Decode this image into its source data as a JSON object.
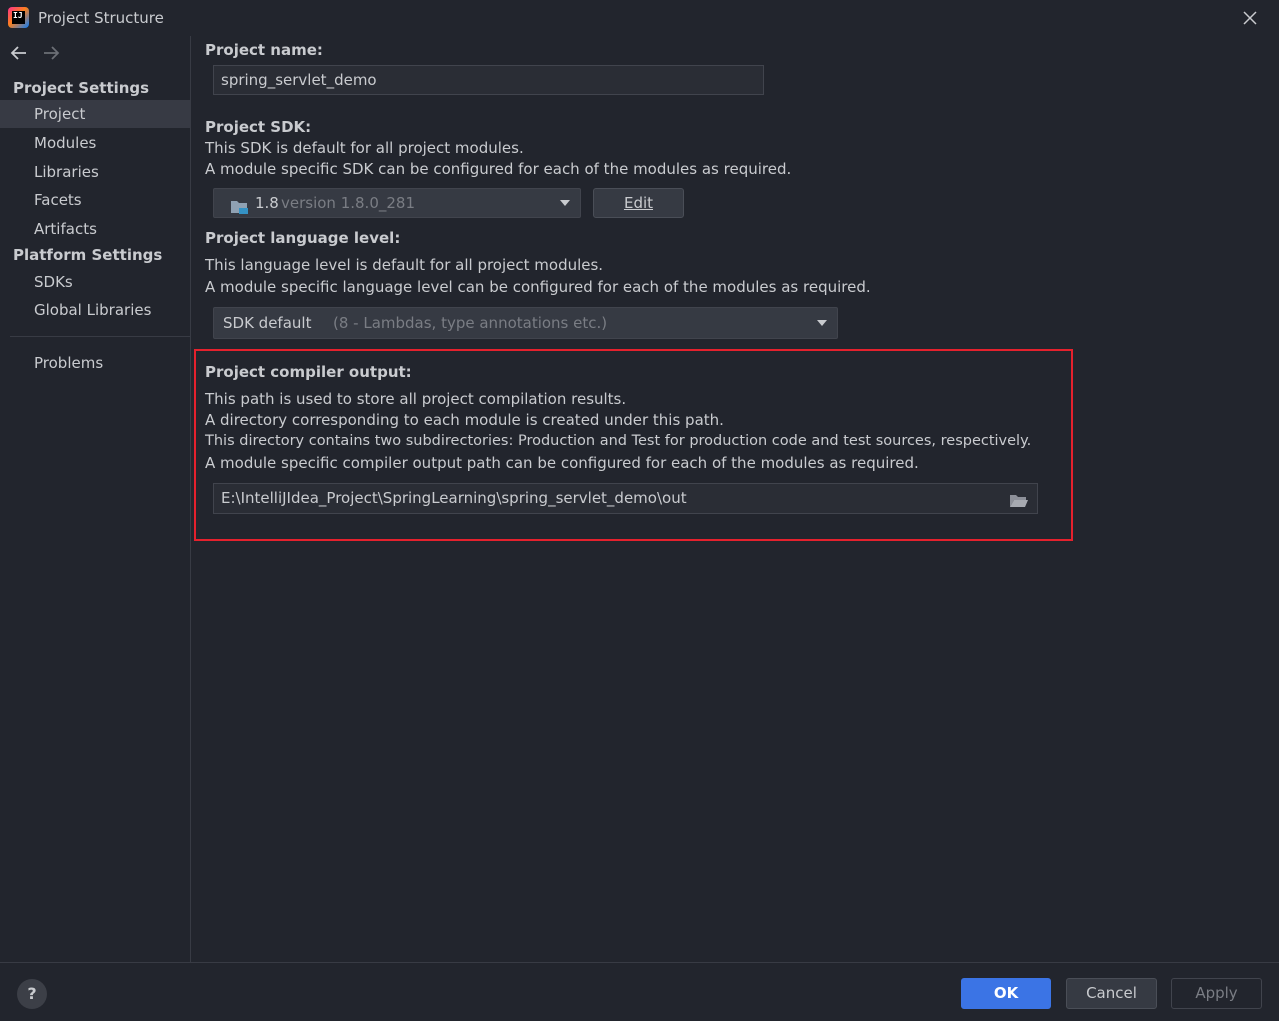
{
  "window": {
    "title": "Project Structure",
    "logo_text": "IJ"
  },
  "sidebar": {
    "project_settings_header": "Project Settings",
    "project_settings_items": [
      {
        "label": "Project",
        "selected": true
      },
      {
        "label": "Modules",
        "selected": false
      },
      {
        "label": "Libraries",
        "selected": false
      },
      {
        "label": "Facets",
        "selected": false
      },
      {
        "label": "Artifacts",
        "selected": false
      }
    ],
    "platform_settings_header": "Platform Settings",
    "platform_settings_items": [
      {
        "label": "SDKs"
      },
      {
        "label": "Global Libraries"
      }
    ],
    "problems_label": "Problems"
  },
  "project_name": {
    "label": "Project name:",
    "value": "spring_servlet_demo"
  },
  "project_sdk": {
    "label": "Project SDK:",
    "desc_line1": "This SDK is default for all project modules.",
    "desc_line2": "A module specific SDK can be configured for each of the modules as required.",
    "selected_name": "1.8",
    "selected_detail": "version 1.8.0_281",
    "edit_label": "Edit"
  },
  "language_level": {
    "label": "Project language level:",
    "desc_line1": "This language level is default for all project modules.",
    "desc_line2": "A module specific language level can be configured for each of the modules as required.",
    "selected_name": "SDK default",
    "selected_detail": "(8 - Lambdas, type annotations etc.)"
  },
  "compiler_output": {
    "label": "Project compiler output:",
    "desc_line1": "This path is used to store all project compilation results.",
    "desc_line2": "A directory corresponding to each module is created under this path.",
    "desc_line3": "This directory contains two subdirectories: Production and Test for production code and test sources, respectively.",
    "desc_line4": "A module specific compiler output path can be configured for each of the modules as required.",
    "path": "E:\\IntelliJIdea_Project\\SpringLearning\\spring_servlet_demo\\out"
  },
  "footer": {
    "help_label": "?",
    "ok_label": "OK",
    "cancel_label": "Cancel",
    "apply_label": "Apply"
  },
  "colors": {
    "background": "#22252d",
    "highlight_border": "#e5212d",
    "primary_button": "#3b74e5",
    "selected_item": "#373a44"
  }
}
